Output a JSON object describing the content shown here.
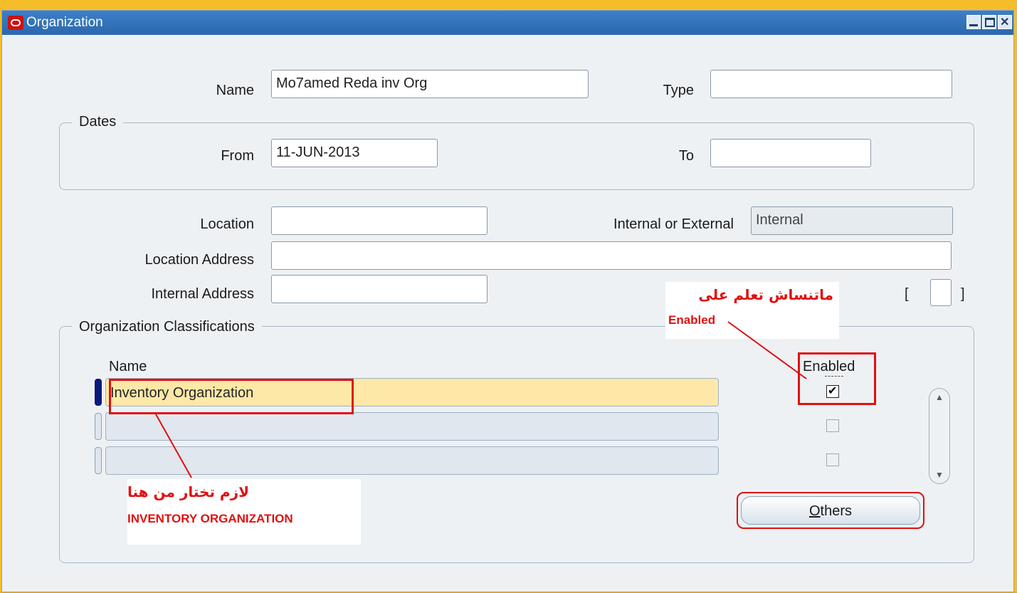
{
  "window": {
    "title": "Organization"
  },
  "header": {
    "name_label": "Name",
    "name_value": "Mo7amed Reda inv Org",
    "type_label": "Type",
    "type_value": ""
  },
  "dates": {
    "title": "Dates",
    "from_label": "From",
    "from_value": "11-JUN-2013",
    "to_label": "To",
    "to_value": ""
  },
  "location": {
    "location_label": "Location",
    "location_value": "",
    "int_ext_label": "Internal or External",
    "int_ext_value": "Internal",
    "address_label": "Location Address",
    "address_value": "",
    "internal_address_label": "Internal Address",
    "internal_address_value": "",
    "bracket_open": "[",
    "bracket_close": "]"
  },
  "classifications": {
    "title": "Organization Classifications",
    "name_header": "Name",
    "enabled_header": "Enabled",
    "rows": [
      {
        "name": "Inventory Organization",
        "enabled": true
      },
      {
        "name": "",
        "enabled": false
      },
      {
        "name": "",
        "enabled": false
      }
    ],
    "others_button_underline": "O",
    "others_button_rest": "thers"
  },
  "annotations": {
    "enabled_note_ar": "ماتنساش تعلم على",
    "enabled_note_en": "Enabled",
    "inventory_note_ar": "لازم تختار من هنا",
    "inventory_note_en": "INVENTORY ORGANIZATION",
    "annotation_color": "#e01010"
  },
  "colors": {
    "titlebar": "#2a68ad",
    "selected_row": "#fde8a8",
    "frame": "#f6bd2a"
  }
}
